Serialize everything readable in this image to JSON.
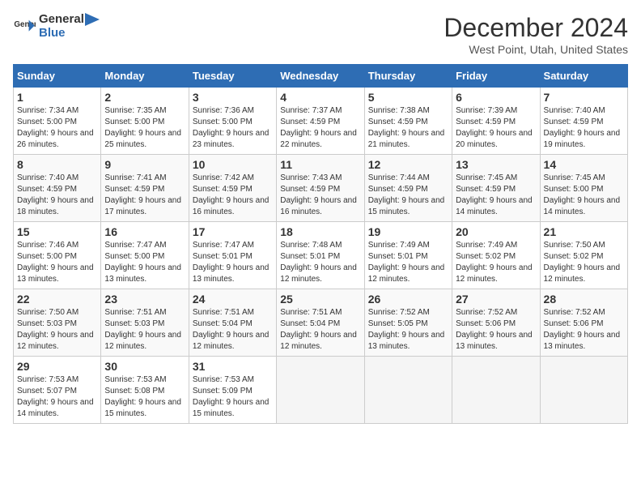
{
  "logo": {
    "text_general": "General",
    "text_blue": "Blue"
  },
  "title": "December 2024",
  "subtitle": "West Point, Utah, United States",
  "days_of_week": [
    "Sunday",
    "Monday",
    "Tuesday",
    "Wednesday",
    "Thursday",
    "Friday",
    "Saturday"
  ],
  "weeks": [
    [
      {
        "day": 1,
        "sunrise": "7:34 AM",
        "sunset": "5:00 PM",
        "daylight": "9 hours and 26 minutes."
      },
      {
        "day": 2,
        "sunrise": "7:35 AM",
        "sunset": "5:00 PM",
        "daylight": "9 hours and 25 minutes."
      },
      {
        "day": 3,
        "sunrise": "7:36 AM",
        "sunset": "5:00 PM",
        "daylight": "9 hours and 23 minutes."
      },
      {
        "day": 4,
        "sunrise": "7:37 AM",
        "sunset": "4:59 PM",
        "daylight": "9 hours and 22 minutes."
      },
      {
        "day": 5,
        "sunrise": "7:38 AM",
        "sunset": "4:59 PM",
        "daylight": "9 hours and 21 minutes."
      },
      {
        "day": 6,
        "sunrise": "7:39 AM",
        "sunset": "4:59 PM",
        "daylight": "9 hours and 20 minutes."
      },
      {
        "day": 7,
        "sunrise": "7:40 AM",
        "sunset": "4:59 PM",
        "daylight": "9 hours and 19 minutes."
      }
    ],
    [
      {
        "day": 8,
        "sunrise": "7:40 AM",
        "sunset": "4:59 PM",
        "daylight": "9 hours and 18 minutes."
      },
      {
        "day": 9,
        "sunrise": "7:41 AM",
        "sunset": "4:59 PM",
        "daylight": "9 hours and 17 minutes."
      },
      {
        "day": 10,
        "sunrise": "7:42 AM",
        "sunset": "4:59 PM",
        "daylight": "9 hours and 16 minutes."
      },
      {
        "day": 11,
        "sunrise": "7:43 AM",
        "sunset": "4:59 PM",
        "daylight": "9 hours and 16 minutes."
      },
      {
        "day": 12,
        "sunrise": "7:44 AM",
        "sunset": "4:59 PM",
        "daylight": "9 hours and 15 minutes."
      },
      {
        "day": 13,
        "sunrise": "7:45 AM",
        "sunset": "4:59 PM",
        "daylight": "9 hours and 14 minutes."
      },
      {
        "day": 14,
        "sunrise": "7:45 AM",
        "sunset": "5:00 PM",
        "daylight": "9 hours and 14 minutes."
      }
    ],
    [
      {
        "day": 15,
        "sunrise": "7:46 AM",
        "sunset": "5:00 PM",
        "daylight": "9 hours and 13 minutes."
      },
      {
        "day": 16,
        "sunrise": "7:47 AM",
        "sunset": "5:00 PM",
        "daylight": "9 hours and 13 minutes."
      },
      {
        "day": 17,
        "sunrise": "7:47 AM",
        "sunset": "5:01 PM",
        "daylight": "9 hours and 13 minutes."
      },
      {
        "day": 18,
        "sunrise": "7:48 AM",
        "sunset": "5:01 PM",
        "daylight": "9 hours and 12 minutes."
      },
      {
        "day": 19,
        "sunrise": "7:49 AM",
        "sunset": "5:01 PM",
        "daylight": "9 hours and 12 minutes."
      },
      {
        "day": 20,
        "sunrise": "7:49 AM",
        "sunset": "5:02 PM",
        "daylight": "9 hours and 12 minutes."
      },
      {
        "day": 21,
        "sunrise": "7:50 AM",
        "sunset": "5:02 PM",
        "daylight": "9 hours and 12 minutes."
      }
    ],
    [
      {
        "day": 22,
        "sunrise": "7:50 AM",
        "sunset": "5:03 PM",
        "daylight": "9 hours and 12 minutes."
      },
      {
        "day": 23,
        "sunrise": "7:51 AM",
        "sunset": "5:03 PM",
        "daylight": "9 hours and 12 minutes."
      },
      {
        "day": 24,
        "sunrise": "7:51 AM",
        "sunset": "5:04 PM",
        "daylight": "9 hours and 12 minutes."
      },
      {
        "day": 25,
        "sunrise": "7:51 AM",
        "sunset": "5:04 PM",
        "daylight": "9 hours and 12 minutes."
      },
      {
        "day": 26,
        "sunrise": "7:52 AM",
        "sunset": "5:05 PM",
        "daylight": "9 hours and 13 minutes."
      },
      {
        "day": 27,
        "sunrise": "7:52 AM",
        "sunset": "5:06 PM",
        "daylight": "9 hours and 13 minutes."
      },
      {
        "day": 28,
        "sunrise": "7:52 AM",
        "sunset": "5:06 PM",
        "daylight": "9 hours and 13 minutes."
      }
    ],
    [
      {
        "day": 29,
        "sunrise": "7:53 AM",
        "sunset": "5:07 PM",
        "daylight": "9 hours and 14 minutes."
      },
      {
        "day": 30,
        "sunrise": "7:53 AM",
        "sunset": "5:08 PM",
        "daylight": "9 hours and 15 minutes."
      },
      {
        "day": 31,
        "sunrise": "7:53 AM",
        "sunset": "5:09 PM",
        "daylight": "9 hours and 15 minutes."
      },
      null,
      null,
      null,
      null
    ]
  ]
}
